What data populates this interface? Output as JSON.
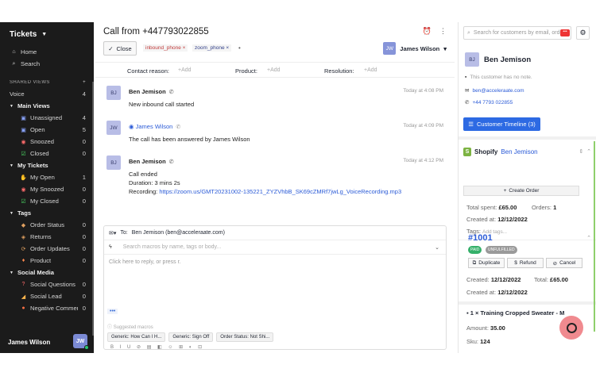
{
  "sidebar": {
    "title": "Tickets",
    "shared_views_label": "SHARED VIEWS",
    "add_symbol": "+",
    "top_items": [
      {
        "label": "Home",
        "icon": "home-icon"
      },
      {
        "label": "Search",
        "icon": "search-icon"
      }
    ],
    "voice": {
      "label": "Voice",
      "count": "4"
    },
    "groups": [
      {
        "label": "Main Views",
        "items": [
          {
            "label": "Unassigned",
            "count": "4",
            "icon": "inbox-icon"
          },
          {
            "label": "Open",
            "count": "5",
            "icon": "inbox-icon"
          },
          {
            "label": "Snoozed",
            "count": "0",
            "icon": "alarm-icon"
          },
          {
            "label": "Closed",
            "count": "0",
            "icon": "check-icon"
          }
        ]
      },
      {
        "label": "My Tickets",
        "items": [
          {
            "label": "My Open",
            "count": "1",
            "icon": "hand-icon"
          },
          {
            "label": "My Snoozed",
            "count": "0",
            "icon": "alarm-icon"
          },
          {
            "label": "My Closed",
            "count": "0",
            "icon": "check-icon"
          }
        ]
      },
      {
        "label": "Tags",
        "items": [
          {
            "label": "Order Status",
            "count": "0",
            "icon": "box-icon"
          },
          {
            "label": "Returns",
            "count": "0",
            "icon": "return-icon"
          },
          {
            "label": "Order Updates",
            "count": "0",
            "icon": "refresh-icon"
          },
          {
            "label": "Product",
            "count": "0",
            "icon": "tag-icon"
          }
        ]
      },
      {
        "label": "Social Media",
        "items": [
          {
            "label": "Social Questions",
            "count": "0",
            "icon": "question-icon"
          },
          {
            "label": "Social Lead",
            "count": "0",
            "icon": "megaphone-icon"
          },
          {
            "label": "Negative Comments",
            "count": "0",
            "icon": "alert-icon"
          }
        ]
      }
    ],
    "user": {
      "name": "James Wilson",
      "initials": "JW"
    }
  },
  "ticket": {
    "title": "Call from +447793022855",
    "close_label": "Close",
    "tags": [
      "inbound_phone",
      "zoom_phone"
    ],
    "more_dot": "•",
    "assignee": {
      "name": "James Wilson",
      "initials": "JW"
    },
    "fields": [
      {
        "label": "Contact reason:",
        "add": "+Add"
      },
      {
        "label": "Product:",
        "add": "+Add"
      },
      {
        "label": "Resolution:",
        "add": "+Add"
      }
    ],
    "messages": [
      {
        "initials": "BJ",
        "name": "Ben Jemison",
        "time": "Today at 4:08 PM",
        "lines": [
          "New inbound call started"
        ]
      },
      {
        "initials": "JW",
        "name": "James Wilson",
        "time": "Today at 4:09 PM",
        "lines": [
          "The call has been answered by James Wilson"
        ]
      },
      {
        "initials": "BJ",
        "name": "Ben Jemison",
        "time": "Today at 4:12 PM",
        "lines": [
          "Call ended",
          "Duration: 3 mins 2s"
        ],
        "recording_label": "Recording:",
        "recording_url": "https://zoom.us/GMT20231002-135221_ZYZVhbB_SK69cZMRf7jwLg_VoiceRecording.mp3"
      }
    ]
  },
  "reply": {
    "to_label": "To:",
    "to_value": "Ben Jemison (ben@acceleraate.com)",
    "macro_placeholder": "Search macros by name, tags or body...",
    "body_placeholder": "Click here to reply, or press r.",
    "dots": "•••",
    "suggested_label": "Suggested macros",
    "macros": [
      "Generic: How Can I H...",
      "Generic: Sign Off",
      "Order Status: Not Shi..."
    ],
    "formatting": "B I U ⊘ ▤ ◧ ☺ ⊞ ◐ ⊡"
  },
  "customer": {
    "search_placeholder": "Search for customers by email, order",
    "initials": "BJ",
    "name": "Ben Jemison",
    "note": "This customer has no note.",
    "email": "ben@acceleraate.com",
    "phone": "+44 7793 022855",
    "timeline_label": "Customer Timeline (3)",
    "shopify": {
      "title": "Shopify",
      "customer_link": "Ben Jemison",
      "create_order_label": "Create Order",
      "total_spent_label": "Total spent:",
      "total_spent": "£65.00",
      "orders_label": "Orders:",
      "orders": "1",
      "created_label": "Created at:",
      "created": "12/12/2022",
      "tags_label": "Tags:",
      "tags_placeholder": "Add tags..."
    },
    "order": {
      "number": "#1001",
      "status_paid": "PAID",
      "status_fulfilled": "UNFULFILLED",
      "duplicate_label": "Duplicate",
      "refund_label": "Refund",
      "cancel_label": "Cancel",
      "created_label": "Created:",
      "created": "12/12/2022",
      "total_label": "Total:",
      "total": "£65.00",
      "created_at_label": "Created at:",
      "created_at": "12/12/2022",
      "item": "1 × Training Cropped Sweater - M",
      "amount_label": "Amount:",
      "amount": "35.00",
      "sku_label": "Sku:",
      "sku": "124"
    }
  },
  "colors": {
    "accent": "#2d6ae3",
    "sidebar_bg": "#1b1b1b",
    "shopify": "#7cb342",
    "chat": "#f08a8f"
  }
}
